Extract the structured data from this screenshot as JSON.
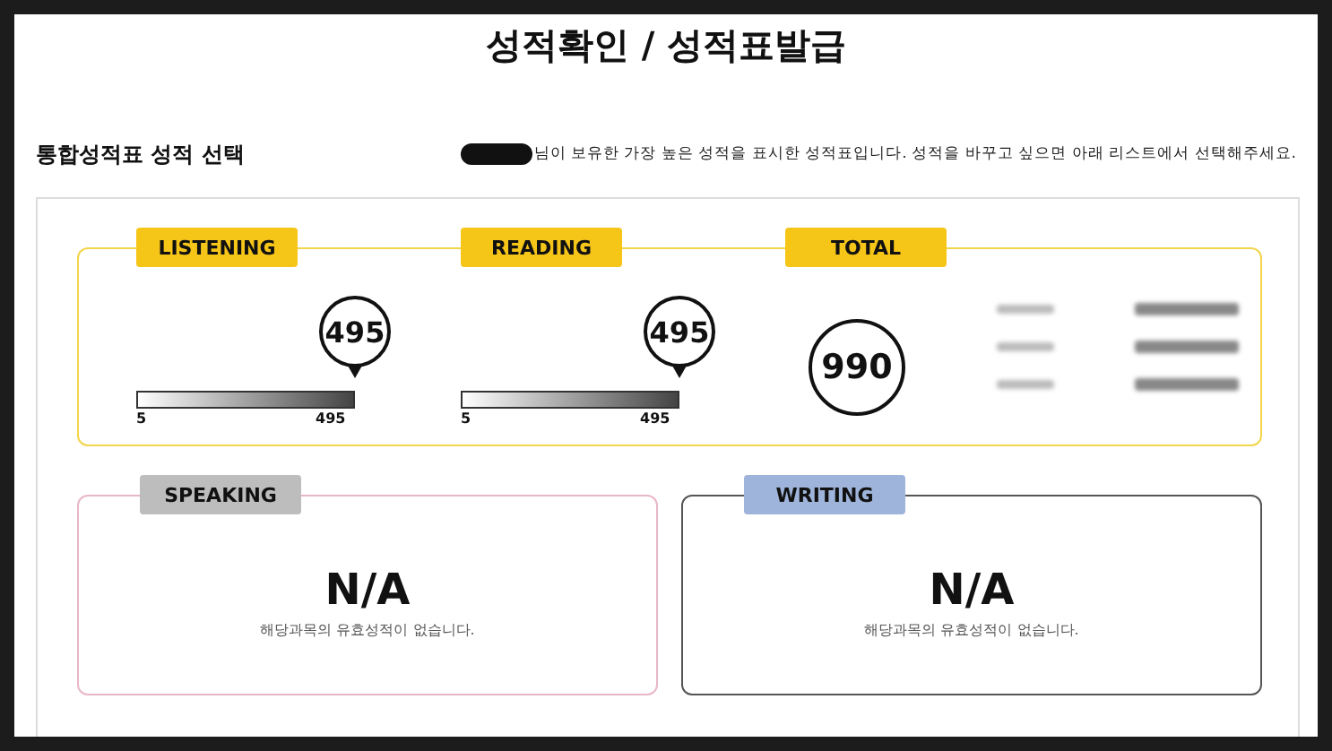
{
  "title": "성적확인 / 성적표발급",
  "section": {
    "heading": "통합성적표 성적 선택",
    "notice": "님이 보유한 가장 높은 성적을 표시한 성적표입니다. 성적을 바꾸고 싶으면 아래 리스트에서 선택해주세요."
  },
  "scores": [
    {
      "kind": "slider",
      "label": "LISTENING",
      "score": "495",
      "level": 1,
      "min": "5",
      "max": "495"
    },
    {
      "kind": "slider",
      "label": "READING",
      "score": "495",
      "level": 1,
      "min": "5",
      "max": "495"
    },
    {
      "kind": "circle",
      "label": "TOTAL",
      "score": "990"
    }
  ],
  "subjects": [
    {
      "label": "SPEAKING",
      "kind": "pink",
      "color": "#bdbdbd",
      "score": "N/A",
      "message": "해당과목의 유효성적이 없습니다."
    },
    {
      "label": "WRITING",
      "kind": "dark",
      "color": "#9fb4da",
      "score": "N/A",
      "message": "해당과목의 유효성적이 없습니다."
    }
  ]
}
